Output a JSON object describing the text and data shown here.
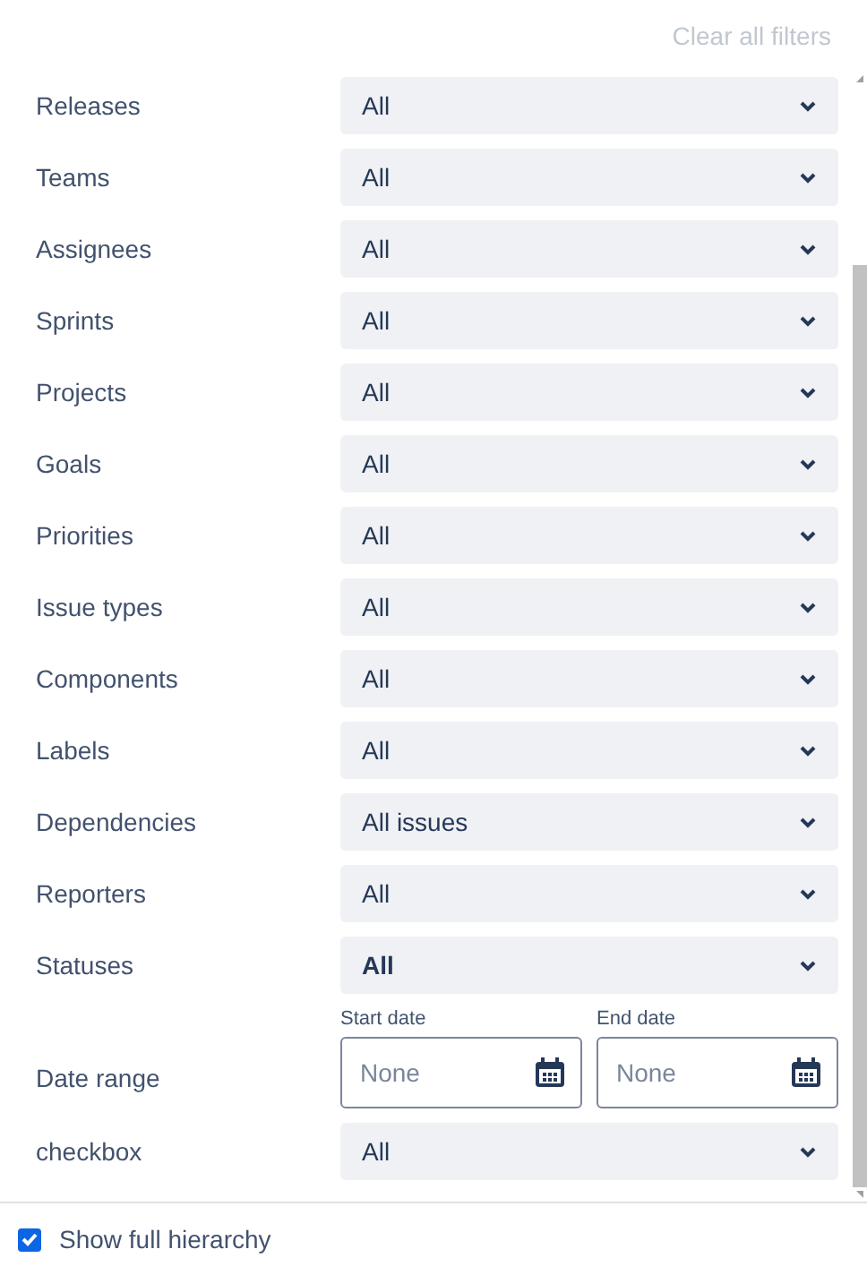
{
  "clear_all": "Clear all filters",
  "filters": [
    {
      "kind": "select",
      "label": "Releases",
      "value": "All",
      "emphasized": false
    },
    {
      "kind": "select",
      "label": "Teams",
      "value": "All",
      "emphasized": false
    },
    {
      "kind": "select",
      "label": "Assignees",
      "value": "All",
      "emphasized": false
    },
    {
      "kind": "select",
      "label": "Sprints",
      "value": "All",
      "emphasized": false
    },
    {
      "kind": "select",
      "label": "Projects",
      "value": "All",
      "emphasized": false
    },
    {
      "kind": "select",
      "label": "Goals",
      "value": "All",
      "emphasized": false
    },
    {
      "kind": "select",
      "label": "Priorities",
      "value": "All",
      "emphasized": false
    },
    {
      "kind": "select",
      "label": "Issue types",
      "value": "All",
      "emphasized": false
    },
    {
      "kind": "select",
      "label": "Components",
      "value": "All",
      "emphasized": false
    },
    {
      "kind": "select",
      "label": "Labels",
      "value": "All",
      "emphasized": false
    },
    {
      "kind": "select",
      "label": "Dependencies",
      "value": "All issues",
      "emphasized": false
    },
    {
      "kind": "select",
      "label": "Reporters",
      "value": "All",
      "emphasized": false
    },
    {
      "kind": "select",
      "label": "Statuses",
      "value": "All",
      "emphasized": true
    },
    {
      "kind": "date_range",
      "label": "Date range",
      "start": {
        "label": "Start date",
        "placeholder": "None"
      },
      "end": {
        "label": "End date",
        "placeholder": "None"
      }
    },
    {
      "kind": "select",
      "label": "checkbox",
      "value": "All",
      "emphasized": false
    }
  ],
  "footer": {
    "label": "Show full hierarchy",
    "checked": true
  }
}
